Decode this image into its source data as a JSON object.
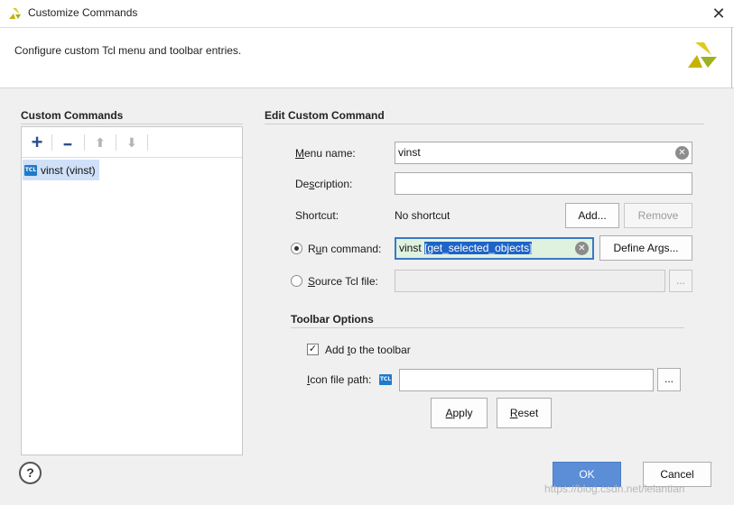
{
  "window": {
    "title": "Customize Commands",
    "close_glyph": "✕",
    "logo_icon": "xilinx-logo-icon"
  },
  "header": {
    "description": "Configure custom Tcl menu and toolbar entries."
  },
  "custom_commands": {
    "title": "Custom Commands",
    "toolbar": {
      "add_glyph": "+",
      "remove_glyph": "━",
      "move_up_glyph": "⬆",
      "move_down_glyph": "⬇"
    },
    "items": [
      {
        "icon_text": "TCL",
        "label": "vinst (vinst)",
        "selected": true
      }
    ]
  },
  "edit": {
    "title": "Edit Custom Command",
    "menu_name_label": "Menu name:",
    "menu_name_value": "vinst",
    "description_label": "Description:",
    "description_value": "",
    "shortcut_label": "Shortcut:",
    "shortcut_value": "No shortcut",
    "add_label": "Add...",
    "remove_label": "Remove",
    "run_command_label": "Run command:",
    "run_command_prefix": "vinst ",
    "run_command_selected": "[get_selected_objects]",
    "define_args_label": "Define Args...",
    "source_label": "Source Tcl file:",
    "source_value": "",
    "browse_label": "...",
    "selected_option": "run_command"
  },
  "toolbar_options": {
    "title": "Toolbar Options",
    "add_to_toolbar_label": "Add to the toolbar",
    "add_to_toolbar_checked": true,
    "icon_path_label": "Icon file path:",
    "icon_path_value": "",
    "icon_text": "TCL",
    "browse_label": "...",
    "apply_label": "Apply",
    "reset_label": "Reset"
  },
  "footer": {
    "help_label": "?",
    "ok_label": "OK",
    "cancel_label": "Cancel"
  },
  "watermark": "https://blog.csdn.net/lelantian",
  "colors": {
    "accent": "#5b8ed6",
    "selection": "#1e64c8",
    "run_field_bg": "#dff1df",
    "list_selection": "#cfe0f8"
  }
}
